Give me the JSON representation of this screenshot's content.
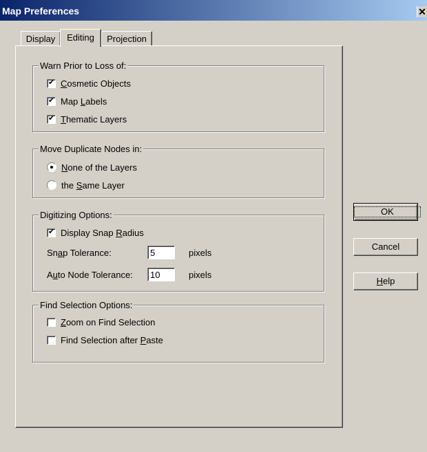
{
  "window": {
    "title": "Map Preferences",
    "close": "✕"
  },
  "tabs": [
    {
      "label": "Display"
    },
    {
      "label": "Editing"
    },
    {
      "label": "Projection"
    }
  ],
  "warn_group": {
    "legend": "Warn Prior to Loss of:",
    "items": [
      {
        "pre": "",
        "u": "C",
        "post": "osmetic Objects",
        "checked": true
      },
      {
        "pre": "Map ",
        "u": "L",
        "post": "abels",
        "checked": true
      },
      {
        "pre": "",
        "u": "T",
        "post": "hematic Layers",
        "checked": true
      }
    ]
  },
  "move_group": {
    "legend": "Move Duplicate Nodes in:",
    "items": [
      {
        "pre": "",
        "u": "N",
        "post": "one of the Layers",
        "selected": true
      },
      {
        "pre": "the ",
        "u": "S",
        "post": "ame Layer",
        "selected": false
      }
    ]
  },
  "digitizing": {
    "legend": "Digitizing Options:",
    "snap_radius": {
      "pre": "Display Snap ",
      "u": "R",
      "post": "adius",
      "checked": true
    },
    "snap_tolerance": {
      "pre": "Sn",
      "u": "a",
      "post": "p Tolerance:",
      "value": "5",
      "unit": "pixels"
    },
    "auto_node": {
      "pre": "A",
      "u": "u",
      "post": "to Node Tolerance:",
      "value": "10",
      "unit": "pixels"
    }
  },
  "find_group": {
    "legend": "Find Selection Options:",
    "items": [
      {
        "pre": "",
        "u": "Z",
        "post": "oom on Find Selection",
        "checked": false
      },
      {
        "pre": "Find Selection after ",
        "u": "P",
        "post": "aste",
        "checked": false
      }
    ]
  },
  "buttons": {
    "ok": "OK",
    "cancel": "Cancel",
    "help_u": "H",
    "help_rest": "elp"
  }
}
